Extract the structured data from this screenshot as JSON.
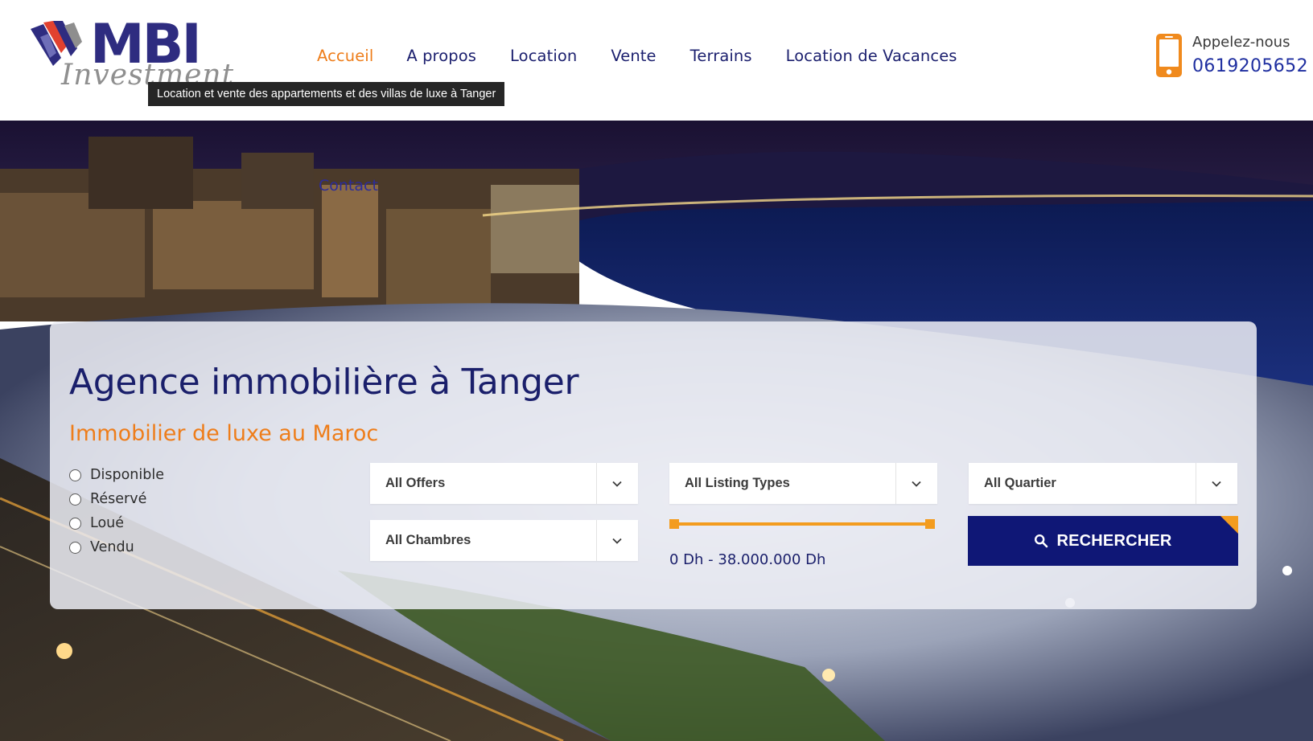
{
  "brand": {
    "name": "MBI",
    "script": "Investment",
    "colors": {
      "navy": "#1a1f6b",
      "orange": "#ee7d1a",
      "button": "#0f1776"
    }
  },
  "tooltip": "Location et vente des appartements et des villas de luxe à Tanger",
  "nav": {
    "items": [
      {
        "label": "Accueil",
        "active": true
      },
      {
        "label": "A propos"
      },
      {
        "label": "Location"
      },
      {
        "label": "Vente"
      },
      {
        "label": "Terrains"
      },
      {
        "label": "Location de Vacances"
      }
    ],
    "contact": "Contact"
  },
  "call": {
    "icon": "phone-icon",
    "label": "Appelez-nous",
    "number": "0619205652"
  },
  "hero": {
    "title": "Agence immobilière à Tanger",
    "subtitle": "Immobilier de luxe au Maroc"
  },
  "search": {
    "statuses": [
      "Disponible",
      "Réservé",
      "Loué",
      "Vendu"
    ],
    "selects": {
      "offers": "All Offers",
      "listing_types": "All Listing Types",
      "quartier": "All Quartier",
      "chambres": "All Chambres"
    },
    "price_range": {
      "min": 0,
      "max": 38000000,
      "label": "0 Dh - 38.000.000 Dh"
    },
    "button": {
      "icon": "search-icon",
      "label": "RECHERCHER"
    }
  }
}
